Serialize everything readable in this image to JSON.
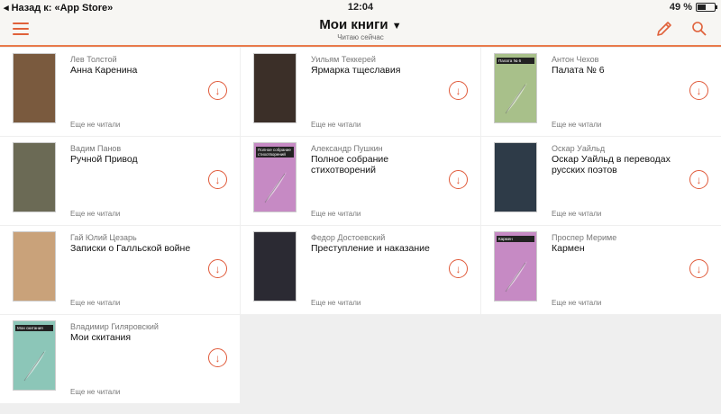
{
  "status_bar": {
    "back_label": "◂ Назад к: «App Store»",
    "time": "12:04",
    "battery": "49 %",
    "battery_level": 0.49
  },
  "nav": {
    "title": "Мои книги",
    "subtitle": "Читаю сейчас"
  },
  "books": [
    {
      "author": "Лев Толстой",
      "title": "Анна Каренина",
      "status": "Еще не читали",
      "cover": {
        "color": "#7a5a3e",
        "caption": ""
      }
    },
    {
      "author": "Уильям Теккерей",
      "title": "Ярмарка тщеславия",
      "status": "Еще не читали",
      "cover": {
        "color": "#3b2f28",
        "caption": ""
      }
    },
    {
      "author": "Антон Чехов",
      "title": "Палата № 6",
      "status": "Еще не читали",
      "cover": {
        "color": "#a8c08a",
        "caption": "Палата № 6"
      }
    },
    {
      "author": "Вадим Панов",
      "title": "Ручной Привод",
      "status": "Еще не читали",
      "cover": {
        "color": "#6b6a55",
        "caption": ""
      }
    },
    {
      "author": "Александр Пушкин",
      "title": "Полное собрание стихотворений",
      "status": "Еще не читали",
      "cover": {
        "color": "#c68ac4",
        "caption": "Полное собрание стихотворений"
      }
    },
    {
      "author": "Оскар Уайльд",
      "title": "Оскар Уайльд в переводах русских поэтов",
      "status": "Еще не читали",
      "cover": {
        "color": "#2e3b48",
        "caption": ""
      }
    },
    {
      "author": "Гай Юлий Цезарь",
      "title": "Записки о Галльской войне",
      "status": "Еще не читали",
      "cover": {
        "color": "#c9a27a",
        "caption": ""
      }
    },
    {
      "author": "Федор Достоевский",
      "title": "Преступление и наказание",
      "status": "Еще не читали",
      "cover": {
        "color": "#2b2a33",
        "caption": ""
      }
    },
    {
      "author": "Проспер Мериме",
      "title": "Кармен",
      "status": "Еще не читали",
      "cover": {
        "color": "#c68ac4",
        "caption": "Кармен"
      }
    },
    {
      "author": "Владимир Гиляровский",
      "title": "Мои скитания",
      "status": "Еще не читали",
      "cover": {
        "color": "#8cc6b8",
        "caption": "Мои скитания"
      }
    }
  ]
}
